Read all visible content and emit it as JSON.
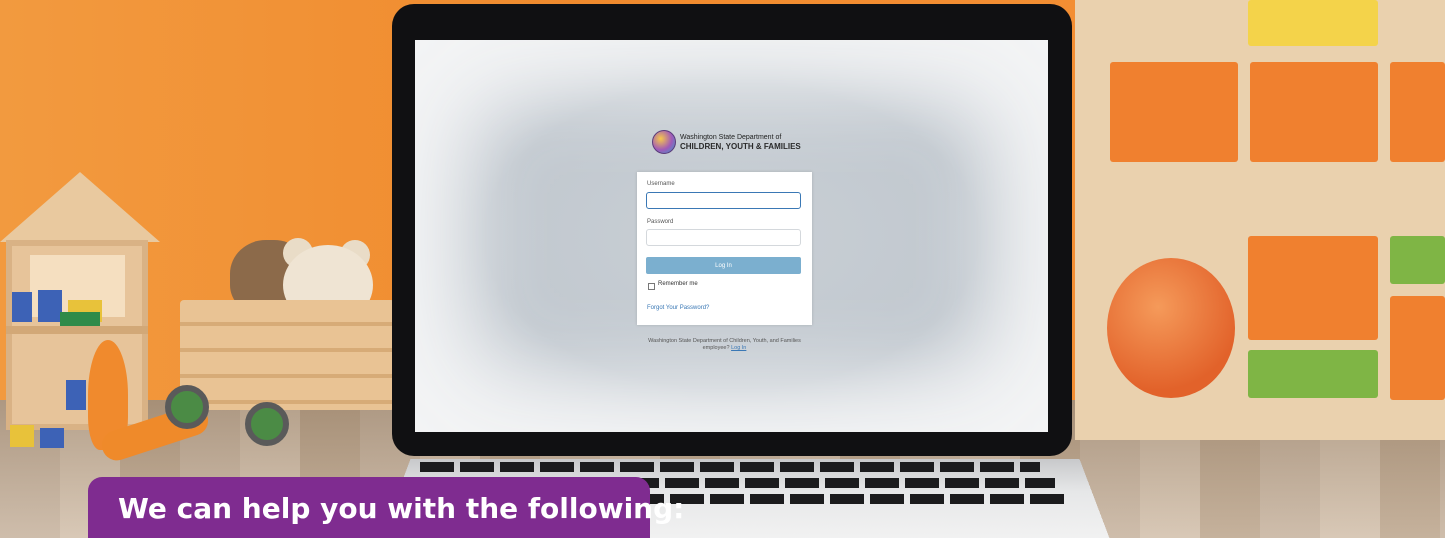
{
  "logo": {
    "line1": "Washington State Department of",
    "line2": "CHILDREN, YOUTH & FAMILIES",
    "icon": "dcyf-logo-icon"
  },
  "login": {
    "username_label": "Username",
    "username_value": "",
    "password_label": "Password",
    "password_value": "",
    "login_button": "Log In",
    "remember_label": "Remember me",
    "remember_checked": false,
    "forgot_link": "Forgot Your Password?"
  },
  "employee": {
    "text": "Washington State Department of Children, Youth, and Families employee?",
    "link": "Log In"
  },
  "banner": {
    "text": "We can help you with the following:",
    "color": "#7f2c90"
  },
  "colors": {
    "background_wall": "#f08a2d",
    "button": "#7bafcf",
    "link": "#3a78b5"
  }
}
